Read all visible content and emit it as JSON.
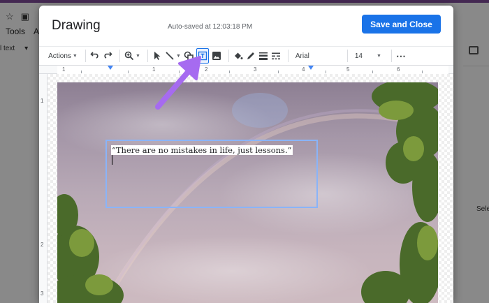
{
  "background_doc": {
    "menu": [
      "Tools",
      "Ad"
    ],
    "style_label": "l text",
    "right_panel_text": "Sele"
  },
  "dialog": {
    "title": "Drawing",
    "autosave": "Auto-saved at 12:03:18 PM",
    "save_button": "Save and Close"
  },
  "toolbar": {
    "actions_label": "Actions",
    "font": "Arial",
    "font_size": "14",
    "more": "⋯",
    "icons": [
      "undo-icon",
      "redo-icon",
      "zoom-icon",
      "select-icon",
      "line-icon",
      "shape-icon",
      "textbox-icon",
      "image-icon",
      "fill-color-icon",
      "border-color-icon",
      "border-weight-icon",
      "border-dash-icon"
    ]
  },
  "ruler": {
    "top_labels": [
      "1",
      "1",
      "2",
      "3",
      "4",
      "5",
      "6"
    ],
    "left_labels": [
      "1",
      "2",
      "3"
    ]
  },
  "canvas": {
    "text": "“There are no mistakes in life, just lessons.”"
  },
  "colors": {
    "accent": "#1a73e8",
    "arrow": "#a66bf0",
    "selection": "#8ab4f8"
  }
}
